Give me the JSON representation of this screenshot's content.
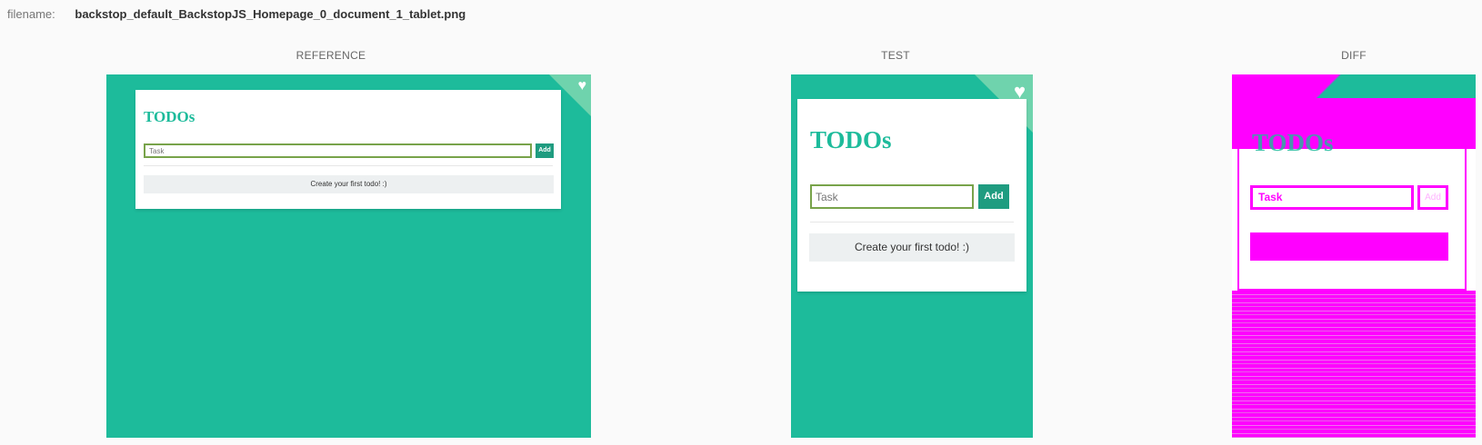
{
  "header": {
    "filename_label": "filename:",
    "filename_value": "backstop_default_BackstopJS_Homepage_0_document_1_tablet.png"
  },
  "panels": {
    "reference_label": "REFERENCE",
    "test_label": "TEST",
    "diff_label": "DIFF"
  },
  "app": {
    "title": "TODOs",
    "input_placeholder": "Task",
    "add_label": "Add",
    "empty_message": "Create your first todo! :)",
    "corner_icon": "cat-icon"
  },
  "diff": {
    "input_text": "Task",
    "add_text": "Add"
  },
  "colors": {
    "primary": "#1dbb9b",
    "button": "#1f9c80",
    "input_border": "#78a34a",
    "diff_highlight": "#ff00ff"
  }
}
